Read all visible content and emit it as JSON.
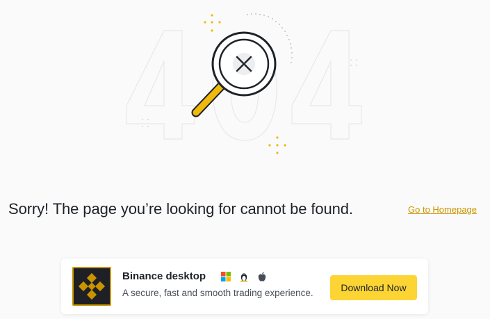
{
  "illustration": {
    "code_text": "404"
  },
  "message": {
    "text": "Sorry! The page you’re looking for cannot be found.",
    "home_link": "Go to Homepage"
  },
  "promo": {
    "title": "Binance desktop",
    "description": "A secure, fast and smooth trading experience.",
    "download_label": "Download Now",
    "platforms": [
      "windows-icon",
      "linux-icon",
      "apple-icon"
    ]
  },
  "colors": {
    "brand_yellow": "#fcd535",
    "brand_gold": "#c99400",
    "text_primary": "#1e2329",
    "background": "#fafafa"
  }
}
